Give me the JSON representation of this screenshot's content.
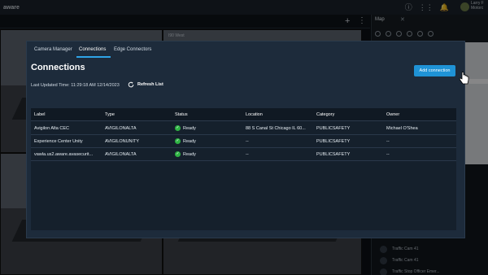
{
  "app": {
    "brand": "aware",
    "user": {
      "name_line1": "Larry F",
      "name_line2": "Motorc"
    }
  },
  "background": {
    "camera_label": "I90 West",
    "map_tab": "Map",
    "side_list": [
      "Traffic Cam 41",
      "Traffic Cam 41",
      "Traffic Stop Officer Emer..."
    ]
  },
  "modal": {
    "tabs": [
      "Camera Manager",
      "Connections",
      "Edge Connectors"
    ],
    "active_tab": "Connections",
    "title": "Connections",
    "add_button": "Add connection",
    "last_updated": "Last Updated Time: 11:29:18 AM 12/14/2023",
    "refresh_label": "Refresh List",
    "columns": [
      "Label",
      "Type",
      "Status",
      "Location",
      "Category",
      "Owner"
    ],
    "rows": [
      {
        "label": "Avigilon Alta CEC",
        "type": "AVIGILONALTA",
        "status": "Ready",
        "location": "88 S Canal St Chicago IL 60...",
        "category": "PUBLICSAFETY",
        "owner": "Michael O'Shea"
      },
      {
        "label": "Experience Center Unity",
        "type": "AVIGILONUNITY",
        "status": "Ready",
        "location": "--",
        "category": "PUBLICSAFETY",
        "owner": "--"
      },
      {
        "label": "vawla.us2.aware.avasecurit...",
        "type": "AVIGILONALTA",
        "status": "Ready",
        "location": "--",
        "category": "PUBLICSAFETY",
        "owner": "--"
      }
    ]
  },
  "colors": {
    "accent": "#1f93d6",
    "modal_bg": "#1d2b3b",
    "ready_green": "#2fb344"
  },
  "icons": [
    "info-icon",
    "grid-icon",
    "bell-icon",
    "refresh-icon",
    "check-circle-icon",
    "hand-cursor-icon",
    "plus-icon",
    "more-icon",
    "close-icon"
  ]
}
